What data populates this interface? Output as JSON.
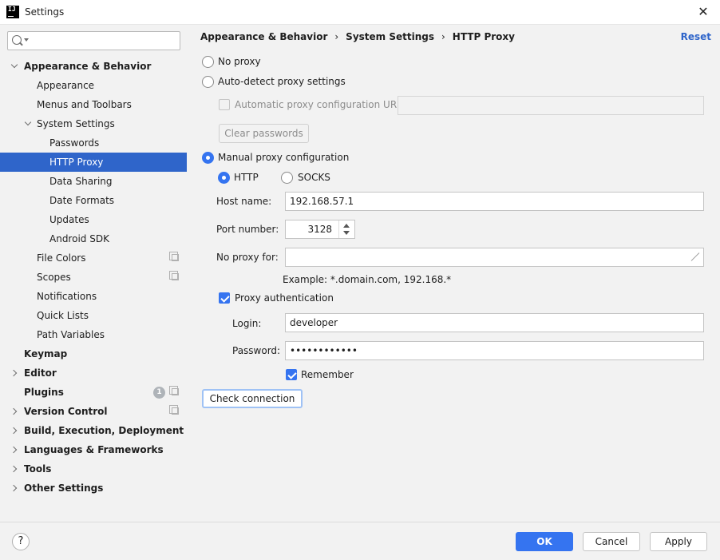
{
  "window": {
    "title": "Settings",
    "app_icon": "intellij-idea-icon"
  },
  "sidebar": {
    "search": {
      "placeholder": "",
      "value": ""
    },
    "items": [
      {
        "label": "Appearance & Behavior",
        "bold": true
      },
      {
        "label": "Appearance"
      },
      {
        "label": "Menus and Toolbars"
      },
      {
        "label": "System Settings"
      },
      {
        "label": "Passwords"
      },
      {
        "label": "HTTP Proxy",
        "selected": true
      },
      {
        "label": "Data Sharing"
      },
      {
        "label": "Date Formats"
      },
      {
        "label": "Updates"
      },
      {
        "label": "Android SDK"
      },
      {
        "label": "File Colors"
      },
      {
        "label": "Scopes"
      },
      {
        "label": "Notifications"
      },
      {
        "label": "Quick Lists"
      },
      {
        "label": "Path Variables"
      },
      {
        "label": "Keymap",
        "bold": true
      },
      {
        "label": "Editor",
        "bold": true
      },
      {
        "label": "Plugins",
        "bold": true,
        "badge": "1"
      },
      {
        "label": "Version Control",
        "bold": true
      },
      {
        "label": "Build, Execution, Deployment",
        "bold": true
      },
      {
        "label": "Languages & Frameworks",
        "bold": true
      },
      {
        "label": "Tools",
        "bold": true
      },
      {
        "label": "Other Settings",
        "bold": true
      }
    ]
  },
  "breadcrumb": {
    "items": [
      "Appearance & Behavior",
      "System Settings",
      "HTTP Proxy"
    ],
    "separator": "›"
  },
  "reset_label": "Reset",
  "proxy": {
    "no_proxy": "No proxy",
    "auto_detect": "Auto-detect proxy settings",
    "auto_config_url_label": "Automatic proxy configuration URL:",
    "auto_config_url_value": "",
    "clear_passwords": "Clear passwords",
    "manual": "Manual proxy configuration",
    "selected_mode": "manual",
    "http": "HTTP",
    "socks": "SOCKS",
    "selected_protocol": "HTTP",
    "host_label": "Host name:",
    "host_value": "192.168.57.1",
    "port_label": "Port number:",
    "port_value": "3128",
    "no_proxy_for_label": "No proxy for:",
    "no_proxy_for_value": "",
    "example": "Example: *.domain.com, 192.168.*",
    "auth_label": "Proxy authentication",
    "auth_checked": true,
    "login_label": "Login:",
    "login_value": "developer",
    "password_label": "Password:",
    "password_value": "••••••••••••",
    "remember_label": "Remember",
    "remember_checked": true,
    "check_connection": "Check connection"
  },
  "footer": {
    "help": "?",
    "ok": "OK",
    "cancel": "Cancel",
    "apply": "Apply"
  },
  "colors": {
    "accent": "#3574f0",
    "selection": "#2f65ca",
    "link": "#2f65ca"
  }
}
